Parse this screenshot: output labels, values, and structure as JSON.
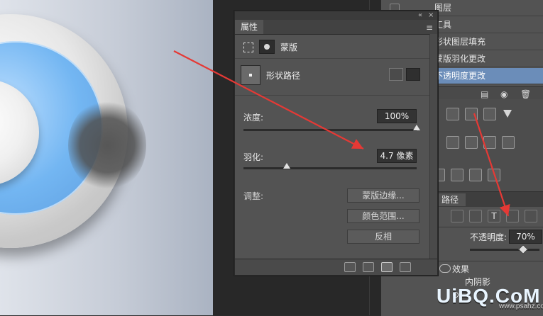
{
  "layers": {
    "rows": [
      {
        "label": "图层",
        "selected": false
      },
      {
        "label": "工具",
        "selected": false
      },
      {
        "label": "形状图层填充",
        "selected": false
      },
      {
        "label": "蒙版羽化更改",
        "selected": false
      },
      {
        "label": "不透明度更改",
        "selected": true
      }
    ],
    "tab_label": "路径",
    "opacity_label": "不透明度:",
    "opacity_value": "70%",
    "effects_label": "效果",
    "effects_item": "内阴影"
  },
  "properties": {
    "tab": "属性",
    "mode_label": "蒙版",
    "shape_label": "形状路径",
    "density_label": "浓度:",
    "density_value": "100%",
    "density_level": 1.0,
    "feather_label": "羽化:",
    "feather_value": "4.7 像素",
    "feather_level": 0.25,
    "adjust_label": "调整:",
    "buttons": {
      "mask_edge": "蒙版边缘...",
      "color_range": "颜色范围...",
      "invert": "反相"
    }
  },
  "watermark": {
    "text": "UiBQ.CoM",
    "small": "www.psahz.com"
  },
  "colors": {
    "panel_bg": "#535353",
    "selected_row": "#6b8db9",
    "arrow_red": "#e53935"
  }
}
